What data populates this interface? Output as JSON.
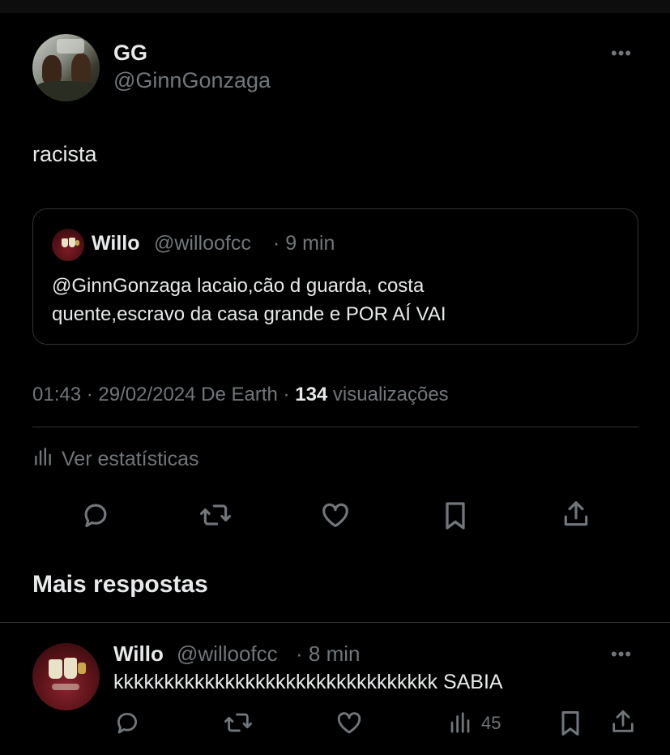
{
  "tweet": {
    "author_name": "GG",
    "author_handle": "@GinnGonzaga",
    "text": "racista",
    "more_label": "•••"
  },
  "quote": {
    "author_name": "Willo",
    "author_handle": "@willoofcc",
    "time": "· 9 min",
    "text_line1": "@GinnGonzaga lacaio,cão d guarda, costa",
    "text_line2": "quente,escravo da casa grande e POR AÍ VAI"
  },
  "meta": {
    "timestamp": "01:43 · 29/02/2024 De Earth · ",
    "views_count": "134",
    "views_label": " visualizações"
  },
  "stats_link": "Ver estatísticas",
  "actions": {
    "icons": [
      "reply-icon",
      "retweet-icon",
      "like-icon",
      "bookmark-icon",
      "share-icon"
    ]
  },
  "replies": {
    "section_title": "Mais respostas",
    "items": [
      {
        "author_name": "Willo",
        "author_handle": "@willoofcc",
        "time": "· 8 min",
        "text": "kkkkkkkkkkkkkkkkkkkkkkkkkkkkkkkk SABIA",
        "views": "45",
        "more_label": "•••"
      }
    ]
  },
  "colors": {
    "background": "#000000",
    "text_primary": "#e7e9ea",
    "text_secondary": "#71767b",
    "border": "#2f3336"
  }
}
